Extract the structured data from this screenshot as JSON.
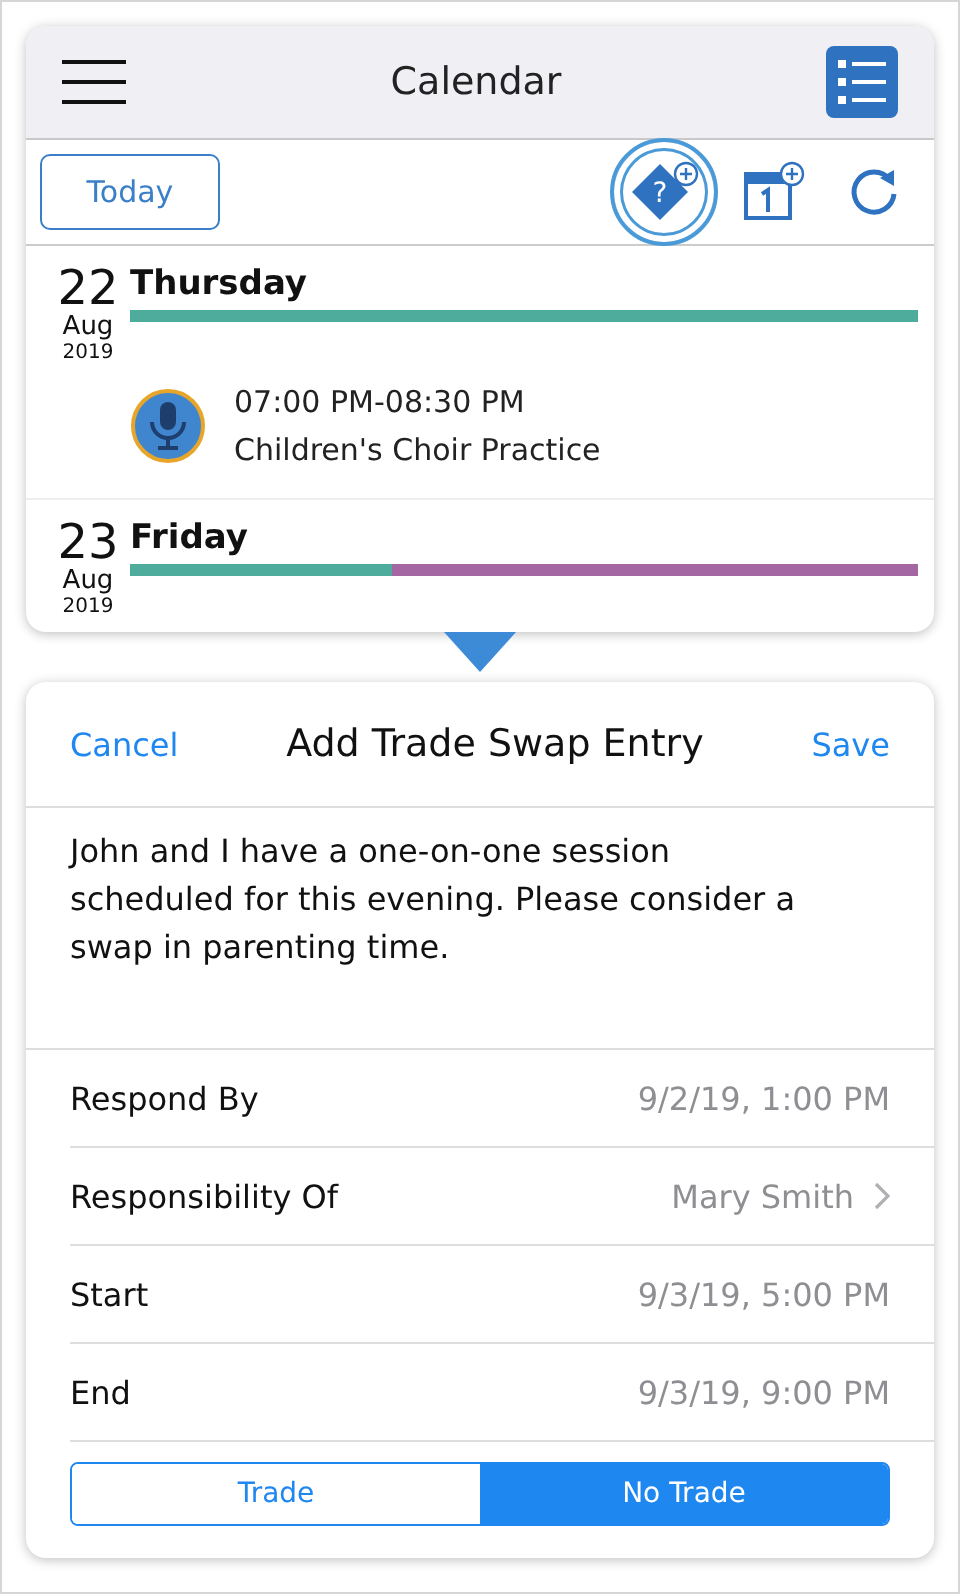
{
  "header": {
    "title": "Calendar"
  },
  "toolbar": {
    "today_button": "Today",
    "tools": [
      {
        "kind": "trade",
        "glyph": "?",
        "selected": true
      },
      {
        "kind": "event",
        "selected": false
      },
      {
        "kind": "refresh",
        "selected": false
      }
    ]
  },
  "days": [
    {
      "day": "22",
      "month": "Aug",
      "year": "2019",
      "weekday": "Thursday",
      "segments": [
        {
          "color": "#4eac9c"
        }
      ],
      "events": [
        {
          "time": "07:00 PM-08:30 PM",
          "title": "Children's Choir Practice"
        }
      ]
    },
    {
      "day": "23",
      "month": "Aug",
      "year": "2019",
      "weekday": "Friday",
      "segments": [
        {
          "color": "#4eac9c"
        },
        {
          "color": "#a566a4"
        },
        {
          "color": "#a566a4"
        }
      ]
    }
  ],
  "sheet": {
    "cancel": "Cancel",
    "title": "Add Trade Swap Entry",
    "save": "Save",
    "message": "John and I have a one-on-one session scheduled for this evening. Please consider a swap in parenting time.",
    "rows": [
      {
        "kind": "plain",
        "label": "Respond By",
        "value": "9/2/19, 1:00 PM"
      },
      {
        "kind": "link",
        "label": "Responsibility Of",
        "value": "Mary Smith"
      },
      {
        "kind": "plain",
        "label": "Start",
        "value": "9/3/19, 5:00 PM"
      },
      {
        "kind": "plain",
        "label": "End",
        "value": "9/3/19, 9:00 PM"
      }
    ],
    "segmented": [
      {
        "label": "Trade",
        "selected": false
      },
      {
        "label": "No Trade",
        "selected": true
      }
    ]
  }
}
